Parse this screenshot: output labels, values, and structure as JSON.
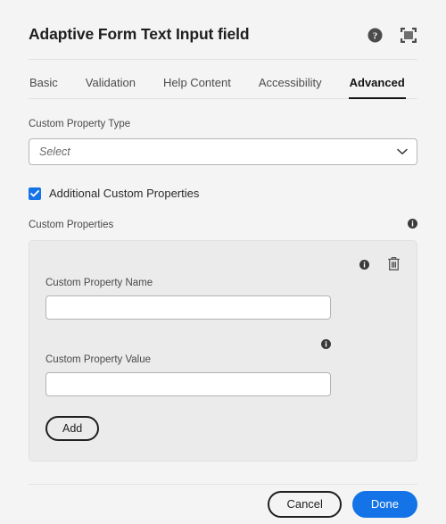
{
  "header": {
    "title": "Adaptive Form Text Input field",
    "help_icon": "help-circle-icon",
    "fullscreen_icon": "fullscreen-icon"
  },
  "tabs": [
    {
      "label": "Basic",
      "active": false
    },
    {
      "label": "Validation",
      "active": false
    },
    {
      "label": "Help Content",
      "active": false
    },
    {
      "label": "Accessibility",
      "active": false
    },
    {
      "label": "Advanced",
      "active": true
    }
  ],
  "fields": {
    "custom_property_type": {
      "label": "Custom Property Type",
      "value": "",
      "placeholder": "Select",
      "chevron_icon": "chevron-down-icon"
    },
    "additional_custom_properties": {
      "label": "Additional Custom Properties",
      "checked": true
    }
  },
  "custom_properties": {
    "section_label": "Custom Properties",
    "section_info_icon": "info-icon",
    "row": {
      "name_label": "Custom Property Name",
      "name_value": "",
      "name_placeholder": "",
      "name_info_icon": "info-icon",
      "delete_icon": "trash-icon",
      "value_label": "Custom Property Value",
      "value_value": "",
      "value_placeholder": "",
      "value_info_icon": "info-icon"
    },
    "add_label": "Add"
  },
  "footer": {
    "cancel_label": "Cancel",
    "done_label": "Done"
  },
  "colors": {
    "accent_blue": "#1473e6",
    "page_background": "#f4f4f4",
    "panel_background": "#ebebeb",
    "text_primary": "#1f1f1f",
    "text_secondary": "#4a4a4a"
  }
}
